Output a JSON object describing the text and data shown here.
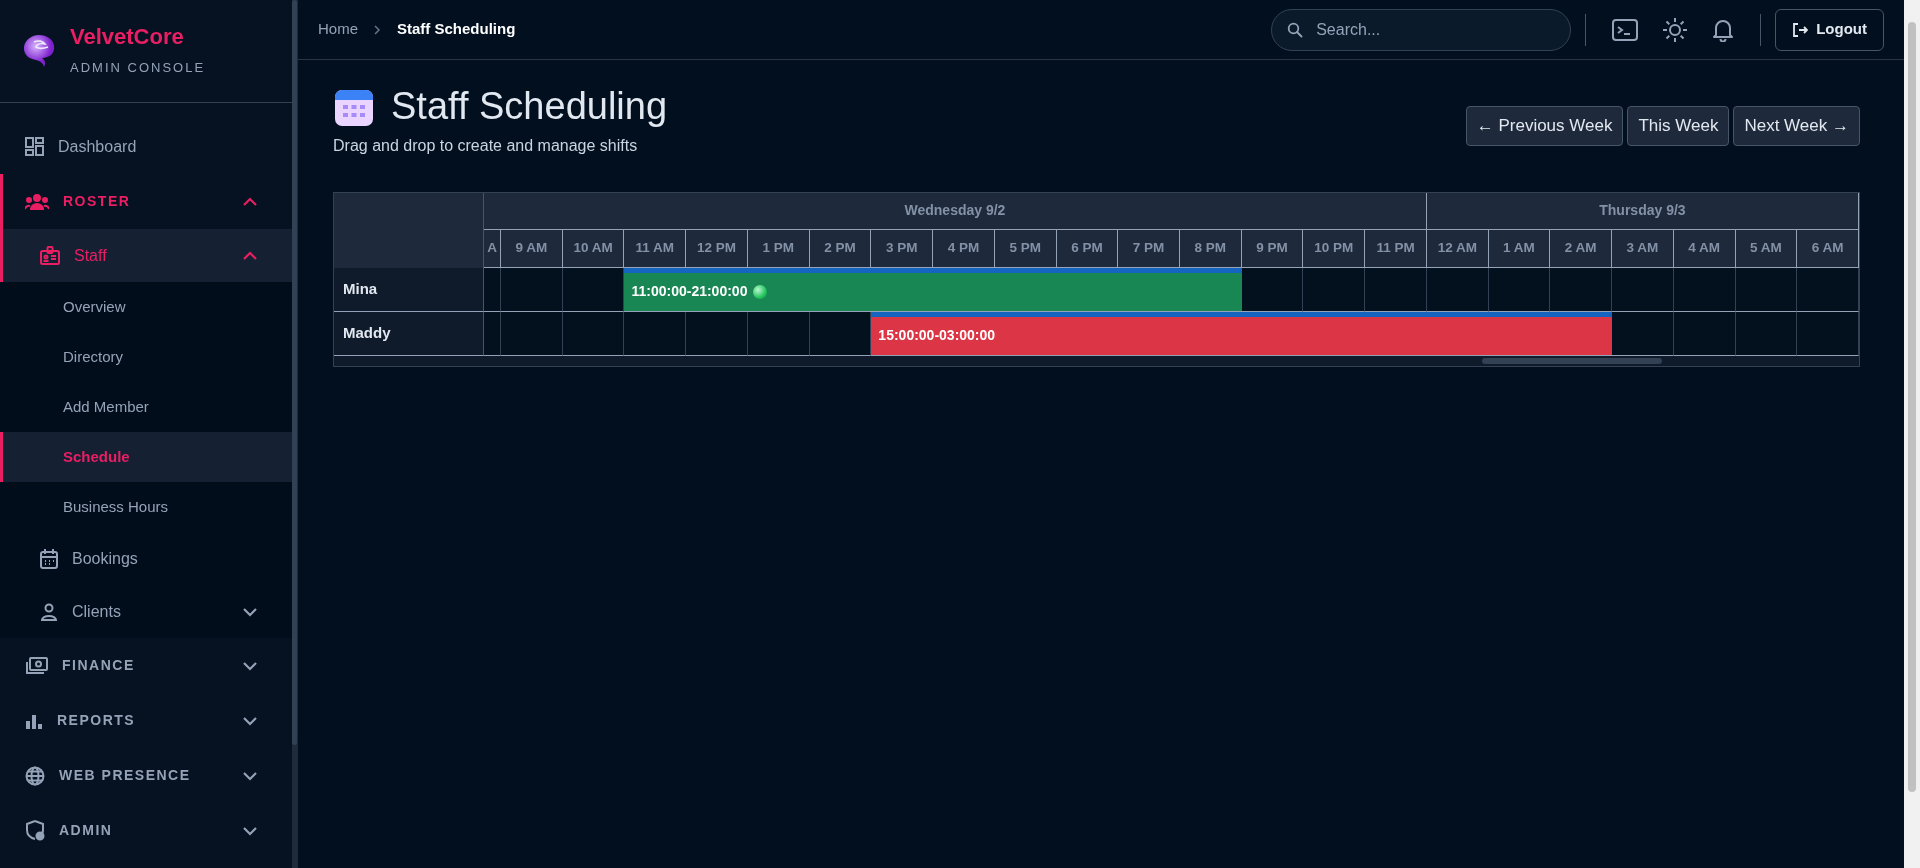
{
  "sidebar": {
    "brand": {
      "name": "VelvetCore",
      "subtitle": "ADMIN CONSOLE"
    },
    "items": [
      {
        "label": "Dashboard",
        "kind": "link",
        "selected": false
      },
      {
        "label": "ROSTER",
        "kind": "section",
        "selected": true,
        "expanded": true,
        "children": [
          {
            "label": "Staff",
            "selected": true,
            "expanded": true,
            "children": [
              {
                "label": "Overview",
                "selected": false
              },
              {
                "label": "Directory",
                "selected": false
              },
              {
                "label": "Add Member",
                "selected": false
              },
              {
                "label": "Schedule",
                "selected": true
              },
              {
                "label": "Business Hours",
                "selected": false
              }
            ]
          },
          {
            "label": "Bookings",
            "selected": false
          },
          {
            "label": "Clients",
            "selected": false,
            "expanded": false
          }
        ]
      },
      {
        "label": "FINANCE",
        "kind": "section",
        "selected": false,
        "expanded": false
      },
      {
        "label": "REPORTS",
        "kind": "section",
        "selected": false,
        "expanded": false
      },
      {
        "label": "WEB PRESENCE",
        "kind": "section",
        "selected": false,
        "expanded": false
      },
      {
        "label": "ADMIN",
        "kind": "section",
        "selected": false,
        "expanded": false
      }
    ]
  },
  "topbar": {
    "breadcrumb": [
      {
        "label": "Home",
        "current": false
      },
      {
        "label": "Staff Scheduling",
        "current": true
      }
    ],
    "search": {
      "placeholder": "Search..."
    },
    "logout": "Logout"
  },
  "header": {
    "title": "Staff Scheduling",
    "subtitle": "Drag and drop to create and manage shifts",
    "buttons": [
      "← Previous Week",
      "This Week",
      "Next Week →"
    ]
  },
  "schedule": {
    "days": [
      {
        "label": "Wednesday 9/2",
        "hours": [
          "A",
          "9 AM",
          "10 AM",
          "11 AM",
          "12 PM",
          "1 PM",
          "2 PM",
          "3 PM",
          "4 PM",
          "5 PM",
          "6 PM",
          "7 PM",
          "8 PM",
          "9 PM",
          "10 PM",
          "11 PM"
        ]
      },
      {
        "label": "Thursday 9/3",
        "hours": [
          "12 AM",
          "1 AM",
          "2 AM",
          "3 AM",
          "4 AM",
          "5 AM",
          "6 AM"
        ]
      }
    ],
    "staff": [
      {
        "name": "Mina",
        "shift": {
          "label": "11:00:00-21:00:00",
          "color": "#198754",
          "active": true
        }
      },
      {
        "name": "Maddy",
        "shift": {
          "label": "15:00:00-03:00:00",
          "color": "#dc3545",
          "active": false
        }
      }
    ]
  }
}
